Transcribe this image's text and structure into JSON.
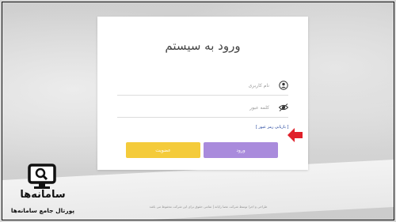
{
  "login": {
    "title": "ورود به سیستم",
    "username_placeholder": "نام کاربری",
    "password_placeholder": "کلمه عبور",
    "forgot_password": "[ بازیابی رمز عبور ]",
    "login_button": "ورود",
    "signup_button": "عضویت"
  },
  "footer": {
    "text": "طراحی و اجرا توسط شرکت عصا رایانه | تمامی حقوق برای این شرکت محفوظ می باشد"
  },
  "logo": {
    "title": "سامانه‌ها",
    "subtitle": "پورتال جامع سامانه‌ها"
  },
  "colors": {
    "login_button": "#a98bdc",
    "signup_button": "#f4cb3b",
    "arrow": "#e0202a",
    "forgot_link": "#1a3d9a"
  },
  "icons": {
    "username": "user-icon",
    "password": "eye-icon",
    "annotation": "red-arrow-icon",
    "logo": "monitor-search-icon"
  }
}
